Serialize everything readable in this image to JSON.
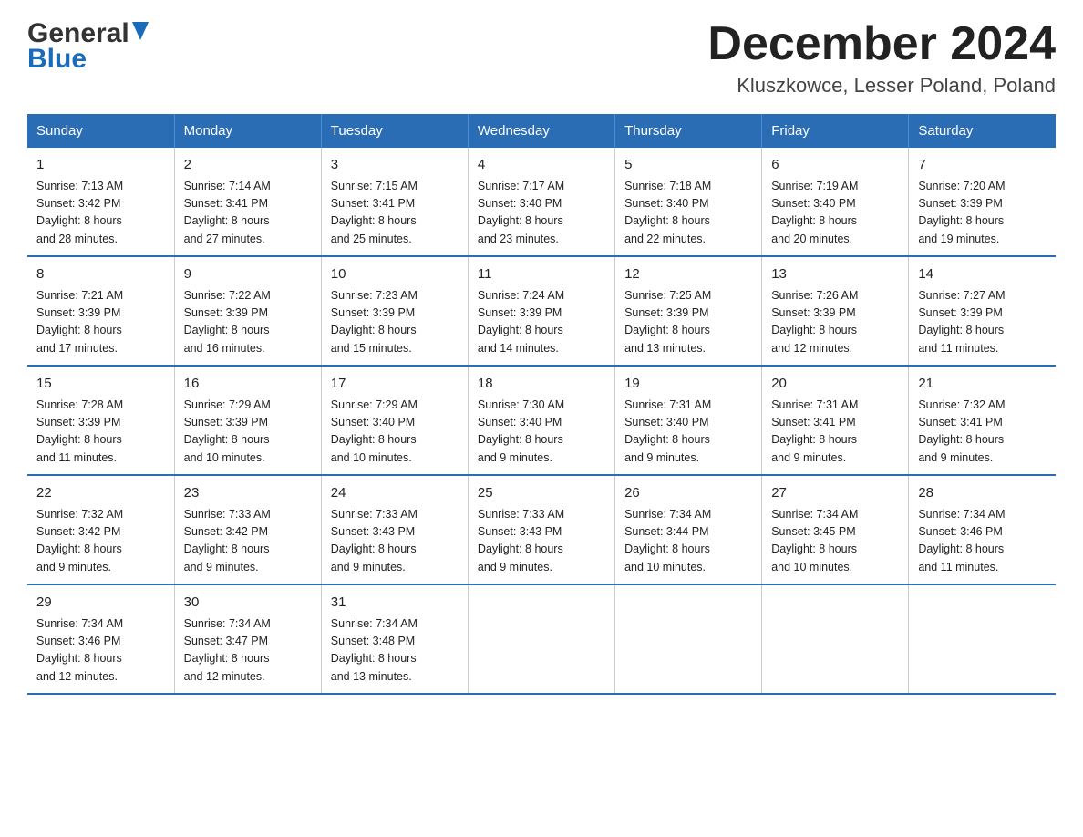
{
  "logo": {
    "general": "General",
    "blue": "Blue"
  },
  "title": "December 2024",
  "subtitle": "Kluszkowce, Lesser Poland, Poland",
  "days_of_week": [
    "Sunday",
    "Monday",
    "Tuesday",
    "Wednesday",
    "Thursday",
    "Friday",
    "Saturday"
  ],
  "weeks": [
    [
      {
        "day": "1",
        "info": "Sunrise: 7:13 AM\nSunset: 3:42 PM\nDaylight: 8 hours\nand 28 minutes."
      },
      {
        "day": "2",
        "info": "Sunrise: 7:14 AM\nSunset: 3:41 PM\nDaylight: 8 hours\nand 27 minutes."
      },
      {
        "day": "3",
        "info": "Sunrise: 7:15 AM\nSunset: 3:41 PM\nDaylight: 8 hours\nand 25 minutes."
      },
      {
        "day": "4",
        "info": "Sunrise: 7:17 AM\nSunset: 3:40 PM\nDaylight: 8 hours\nand 23 minutes."
      },
      {
        "day": "5",
        "info": "Sunrise: 7:18 AM\nSunset: 3:40 PM\nDaylight: 8 hours\nand 22 minutes."
      },
      {
        "day": "6",
        "info": "Sunrise: 7:19 AM\nSunset: 3:40 PM\nDaylight: 8 hours\nand 20 minutes."
      },
      {
        "day": "7",
        "info": "Sunrise: 7:20 AM\nSunset: 3:39 PM\nDaylight: 8 hours\nand 19 minutes."
      }
    ],
    [
      {
        "day": "8",
        "info": "Sunrise: 7:21 AM\nSunset: 3:39 PM\nDaylight: 8 hours\nand 17 minutes."
      },
      {
        "day": "9",
        "info": "Sunrise: 7:22 AM\nSunset: 3:39 PM\nDaylight: 8 hours\nand 16 minutes."
      },
      {
        "day": "10",
        "info": "Sunrise: 7:23 AM\nSunset: 3:39 PM\nDaylight: 8 hours\nand 15 minutes."
      },
      {
        "day": "11",
        "info": "Sunrise: 7:24 AM\nSunset: 3:39 PM\nDaylight: 8 hours\nand 14 minutes."
      },
      {
        "day": "12",
        "info": "Sunrise: 7:25 AM\nSunset: 3:39 PM\nDaylight: 8 hours\nand 13 minutes."
      },
      {
        "day": "13",
        "info": "Sunrise: 7:26 AM\nSunset: 3:39 PM\nDaylight: 8 hours\nand 12 minutes."
      },
      {
        "day": "14",
        "info": "Sunrise: 7:27 AM\nSunset: 3:39 PM\nDaylight: 8 hours\nand 11 minutes."
      }
    ],
    [
      {
        "day": "15",
        "info": "Sunrise: 7:28 AM\nSunset: 3:39 PM\nDaylight: 8 hours\nand 11 minutes."
      },
      {
        "day": "16",
        "info": "Sunrise: 7:29 AM\nSunset: 3:39 PM\nDaylight: 8 hours\nand 10 minutes."
      },
      {
        "day": "17",
        "info": "Sunrise: 7:29 AM\nSunset: 3:40 PM\nDaylight: 8 hours\nand 10 minutes."
      },
      {
        "day": "18",
        "info": "Sunrise: 7:30 AM\nSunset: 3:40 PM\nDaylight: 8 hours\nand 9 minutes."
      },
      {
        "day": "19",
        "info": "Sunrise: 7:31 AM\nSunset: 3:40 PM\nDaylight: 8 hours\nand 9 minutes."
      },
      {
        "day": "20",
        "info": "Sunrise: 7:31 AM\nSunset: 3:41 PM\nDaylight: 8 hours\nand 9 minutes."
      },
      {
        "day": "21",
        "info": "Sunrise: 7:32 AM\nSunset: 3:41 PM\nDaylight: 8 hours\nand 9 minutes."
      }
    ],
    [
      {
        "day": "22",
        "info": "Sunrise: 7:32 AM\nSunset: 3:42 PM\nDaylight: 8 hours\nand 9 minutes."
      },
      {
        "day": "23",
        "info": "Sunrise: 7:33 AM\nSunset: 3:42 PM\nDaylight: 8 hours\nand 9 minutes."
      },
      {
        "day": "24",
        "info": "Sunrise: 7:33 AM\nSunset: 3:43 PM\nDaylight: 8 hours\nand 9 minutes."
      },
      {
        "day": "25",
        "info": "Sunrise: 7:33 AM\nSunset: 3:43 PM\nDaylight: 8 hours\nand 9 minutes."
      },
      {
        "day": "26",
        "info": "Sunrise: 7:34 AM\nSunset: 3:44 PM\nDaylight: 8 hours\nand 10 minutes."
      },
      {
        "day": "27",
        "info": "Sunrise: 7:34 AM\nSunset: 3:45 PM\nDaylight: 8 hours\nand 10 minutes."
      },
      {
        "day": "28",
        "info": "Sunrise: 7:34 AM\nSunset: 3:46 PM\nDaylight: 8 hours\nand 11 minutes."
      }
    ],
    [
      {
        "day": "29",
        "info": "Sunrise: 7:34 AM\nSunset: 3:46 PM\nDaylight: 8 hours\nand 12 minutes."
      },
      {
        "day": "30",
        "info": "Sunrise: 7:34 AM\nSunset: 3:47 PM\nDaylight: 8 hours\nand 12 minutes."
      },
      {
        "day": "31",
        "info": "Sunrise: 7:34 AM\nSunset: 3:48 PM\nDaylight: 8 hours\nand 13 minutes."
      },
      {
        "day": "",
        "info": ""
      },
      {
        "day": "",
        "info": ""
      },
      {
        "day": "",
        "info": ""
      },
      {
        "day": "",
        "info": ""
      }
    ]
  ]
}
